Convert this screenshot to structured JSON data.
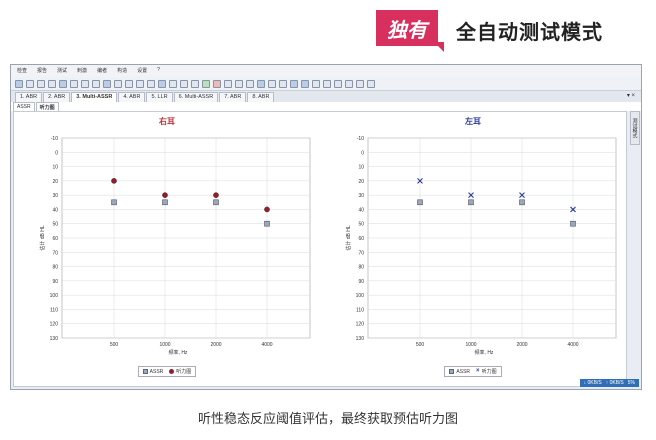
{
  "banner": {
    "badge": "独有",
    "title": "全自动测试模式"
  },
  "menu": [
    "检查",
    "报告",
    "测试",
    "刺激",
    "编者",
    "构造",
    "设置",
    "?"
  ],
  "tabs": [
    {
      "label": "1. ABR",
      "active": false
    },
    {
      "label": "2. ABR",
      "active": false
    },
    {
      "label": "3. Multi-ASSR",
      "active": true
    },
    {
      "label": "4. ABR",
      "active": false
    },
    {
      "label": "5. LLR",
      "active": false
    },
    {
      "label": "6. Multi-ASSR",
      "active": false
    },
    {
      "label": "7. ABR",
      "active": false
    },
    {
      "label": "8. ABR",
      "active": false
    }
  ],
  "window_controls": "▾ ×",
  "subtabs": [
    {
      "label": "ASSR",
      "active": false
    },
    {
      "label": "听力图",
      "active": true
    }
  ],
  "side_tab": "测试模式",
  "status": {
    "down": "0KB/S",
    "up": "0KB/S",
    "pct": "5%"
  },
  "caption": "听性稳态反应阈值评估，最终获取预估听力图",
  "colors": {
    "right_ear": "#c0303a",
    "left_ear": "#2b3b9c",
    "assr_marker": "#9ca7b8"
  },
  "chart_data": [
    {
      "type": "scatter",
      "title": "右耳",
      "xlabel": "频率, Hz",
      "ylabel": "估计 dB HL",
      "categories": [
        "500",
        "1000",
        "2000",
        "4000"
      ],
      "ylim": [
        -10,
        130
      ],
      "yticks": [
        -10,
        0,
        10,
        20,
        30,
        40,
        50,
        60,
        70,
        80,
        90,
        100,
        110,
        120,
        130
      ],
      "y_inverted": true,
      "grid": true,
      "legend": "bottom-center",
      "series": [
        {
          "name": "ASSR",
          "marker": "square",
          "values": [
            35,
            35,
            35,
            50
          ]
        },
        {
          "name": "听力图",
          "marker": "circle",
          "values": [
            20,
            30,
            30,
            40
          ]
        }
      ]
    },
    {
      "type": "scatter",
      "title": "左耳",
      "xlabel": "频率, Hz",
      "ylabel": "估计 dB HL",
      "categories": [
        "500",
        "1000",
        "2000",
        "4000"
      ],
      "ylim": [
        -10,
        130
      ],
      "yticks": [
        -10,
        0,
        10,
        20,
        30,
        40,
        50,
        60,
        70,
        80,
        90,
        100,
        110,
        120,
        130
      ],
      "y_inverted": true,
      "grid": true,
      "legend": "bottom-center",
      "series": [
        {
          "name": "ASSR",
          "marker": "square",
          "values": [
            35,
            35,
            35,
            50
          ]
        },
        {
          "name": "听力图",
          "marker": "x",
          "values": [
            20,
            30,
            30,
            40
          ]
        }
      ]
    }
  ]
}
